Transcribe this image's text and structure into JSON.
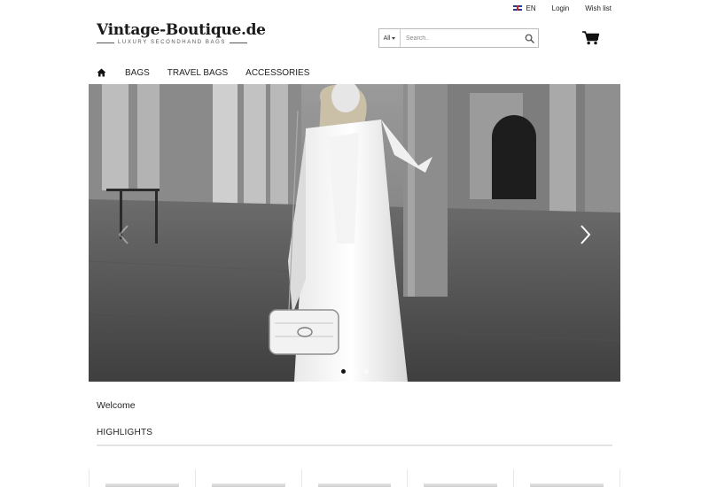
{
  "topbar": {
    "language": "EN",
    "login": "Login",
    "wishlist": "Wish list"
  },
  "logo": {
    "title": "Vintage-Boutique.de",
    "tagline": "LUXURY SECONDHAND BAGS"
  },
  "search": {
    "category": "All",
    "placeholder": "Search.."
  },
  "icons": {
    "home": "home-icon",
    "search": "search-icon",
    "cart": "cart-icon",
    "flag": "uk-flag-icon",
    "prev": "chevron-left-icon",
    "next": "chevron-right-icon"
  },
  "nav": {
    "items": [
      "BAGS",
      "TRAVEL BAGS",
      "ACCESSORIES"
    ]
  },
  "carousel": {
    "slide_count": 3,
    "active_index": 1
  },
  "content": {
    "welcome": "Welcome",
    "highlights": "HIGHLIGHTS"
  },
  "colors": {
    "text": "#222222",
    "rule": "#e3e3e3",
    "border": "#bbbbbb"
  }
}
